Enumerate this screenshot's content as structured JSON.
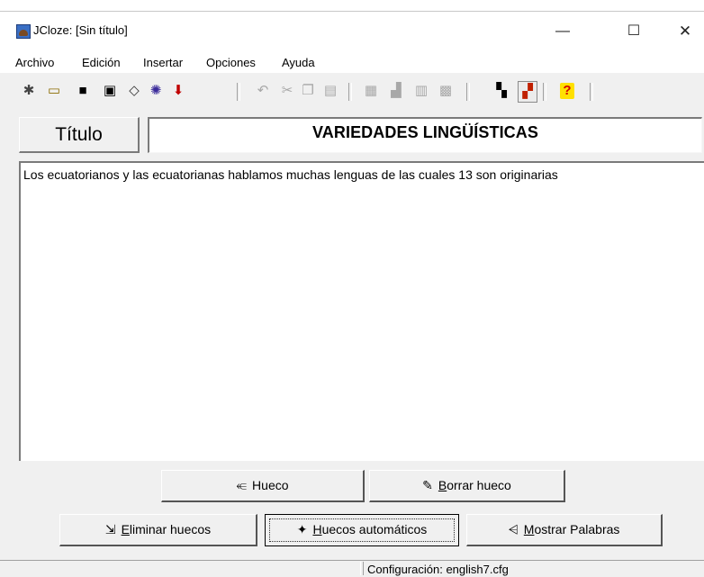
{
  "window": {
    "title": "JCloze: [Sin título]",
    "icon": "jcloze-app-icon",
    "controls": {
      "minimize": "—",
      "maximize": "☐",
      "close": "✕"
    }
  },
  "menu": [
    "Archivo",
    "Edición",
    "Insertar",
    "Opciones",
    "Ayuda"
  ],
  "toolbar": {
    "icons": [
      "new-file-icon",
      "open-folder-icon",
      "save-icon",
      "save-as-icon",
      "eraser-icon",
      "export-web-icon",
      "download-arrow-icon",
      "undo-icon",
      "cut-icon",
      "copy-icon",
      "paste-icon",
      "gap-add-icon",
      "gap-clear-icon",
      "gap-list-icon",
      "gap-auto-icon",
      "toggle-view-icon",
      "toggle-format-icon",
      "help-icon"
    ]
  },
  "titulo": {
    "label": "Título",
    "value": "VARIEDADES LINGÜÍSTICAS"
  },
  "editor": {
    "text": "Los ecuatorianos y las ecuatorianas hablamos muchas lenguas de las cuales 13 son originarias"
  },
  "buttons": {
    "hueco": "Hueco",
    "borrar_hueco_access": "B",
    "borrar_hueco_rest": "orrar hueco",
    "eliminar_huecos_access": "E",
    "eliminar_huecos_rest": "liminar huecos",
    "huecos_automaticos_access": "H",
    "huecos_automaticos_rest": "uecos automáticos",
    "mostrar_palabras_access": "M",
    "mostrar_palabras_rest": "ostrar Palabras"
  },
  "status": {
    "config": "Configuración: english7.cfg"
  }
}
